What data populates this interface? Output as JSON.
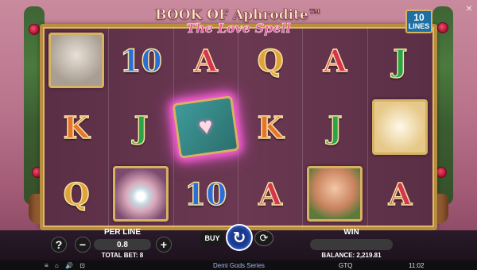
{
  "close_icon": "×",
  "logo": {
    "main": "BOOK OF Aphrodite™",
    "sub": "The Love Spell"
  },
  "lines_badge": {
    "number": "10",
    "label": "LINES"
  },
  "reels": [
    [
      {
        "type": "pic",
        "kind": "statue"
      },
      {
        "type": "letter",
        "text": "K",
        "color": "orange"
      },
      {
        "type": "letter",
        "text": "Q",
        "color": "gold"
      }
    ],
    [
      {
        "type": "letter",
        "text": "10",
        "color": "blue"
      },
      {
        "type": "letter",
        "text": "J",
        "color": "green"
      },
      {
        "type": "pic",
        "kind": "pearl"
      }
    ],
    [
      {
        "type": "letter",
        "text": "A",
        "color": "red"
      },
      {
        "type": "book"
      },
      {
        "type": "letter",
        "text": "10",
        "color": "blue"
      }
    ],
    [
      {
        "type": "letter",
        "text": "Q",
        "color": "gold"
      },
      {
        "type": "letter",
        "text": "K",
        "color": "orange"
      },
      {
        "type": "letter",
        "text": "A",
        "color": "red"
      }
    ],
    [
      {
        "type": "letter",
        "text": "A",
        "color": "red"
      },
      {
        "type": "letter",
        "text": "J",
        "color": "green"
      },
      {
        "type": "pic",
        "kind": "goddess"
      }
    ],
    [
      {
        "type": "letter",
        "text": "J",
        "color": "green"
      },
      {
        "type": "pic",
        "kind": "dove"
      },
      {
        "type": "letter",
        "text": "A",
        "color": "red"
      }
    ]
  ],
  "controls": {
    "help": "?",
    "minus": "−",
    "plus": "+",
    "per_line_label": "PER LINE",
    "per_line_value": "0.8",
    "total_bet": "TOTAL BET: 8",
    "buy": "BUY",
    "spin": "↻",
    "autoplay": "⟳",
    "win_label": "WIN",
    "win_value": "",
    "balance": "BALANCE: 2,219.81"
  },
  "status": {
    "icons": "≡ ⌂ 🔊 ⊡",
    "brand": "Demi Gods Series",
    "currency": "GTQ",
    "clock": "11:02"
  }
}
